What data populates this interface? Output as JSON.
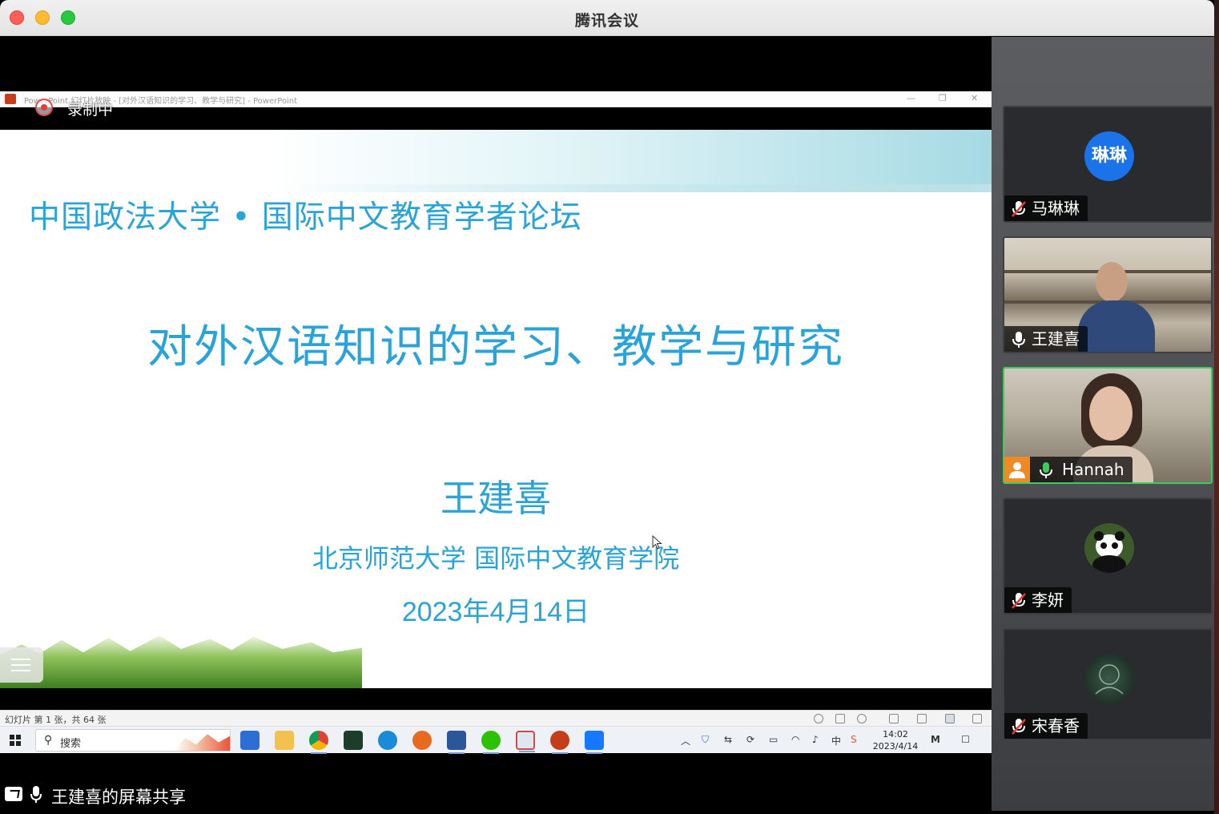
{
  "window": {
    "title": "腾讯会议"
  },
  "powerpoint": {
    "title_bar": "PowerPoint 幻灯片放映 - [对外汉语知识的学习、教学与研究] - PowerPoint",
    "min": "—",
    "restore": "❐",
    "close": "✕"
  },
  "recording": {
    "label": "录制中"
  },
  "slide": {
    "header": "中国政法大学 • 国际中文教育学者论坛",
    "title": "对外汉语知识的学习、教学与研究",
    "author": "王建喜",
    "institution": "北京师范大学 国际中文教育学院",
    "date": "2023年4月14日"
  },
  "statusbar": {
    "text": "幻灯片 第 1 张，共 64 张"
  },
  "taskbar": {
    "search_placeholder": "搜索",
    "clock_time": "14:02",
    "clock_date": "2023/4/14"
  },
  "share": {
    "label": "王建喜的屏幕共享"
  },
  "participants": [
    {
      "name": "马琳琳",
      "avatar_text": "琳琳",
      "avatar_color": "#1a73e8",
      "muted": true
    },
    {
      "name": "王建喜",
      "muted": false,
      "video": true
    },
    {
      "name": "Hannah",
      "muted": false,
      "video": true,
      "speaking": true,
      "host": true
    },
    {
      "name": "李妍",
      "muted": true,
      "avatar_icon": "panda-avatar"
    },
    {
      "name": "宋春香",
      "muted": true,
      "avatar_icon": "sketch-avatar"
    }
  ],
  "colors": {
    "slide_text": "#2aa3d8",
    "speaking_border": "#3ccb5e",
    "muted_red": "#e53935"
  }
}
